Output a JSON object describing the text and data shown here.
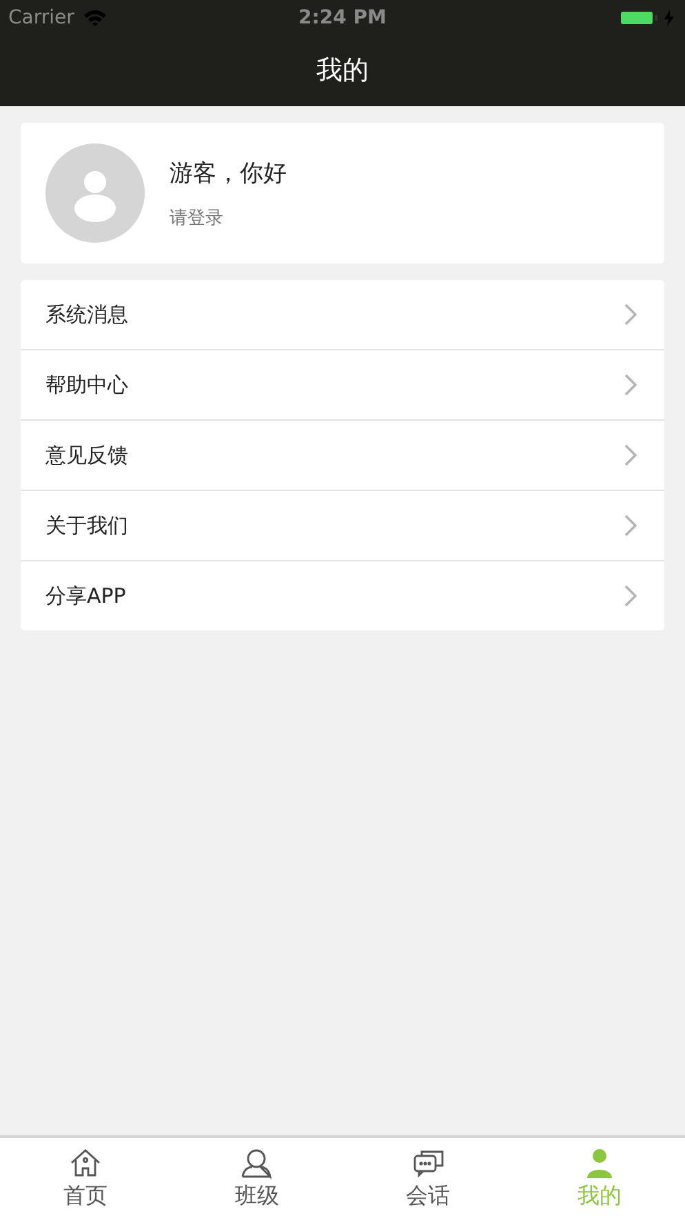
{
  "status_bar": {
    "carrier": "Carrier",
    "time": "2:24 PM"
  },
  "nav_bar": {
    "title": "我的"
  },
  "profile": {
    "name": "游客，你好",
    "subtitle": "请登录"
  },
  "menu": [
    {
      "label": "系统消息"
    },
    {
      "label": "帮助中心"
    },
    {
      "label": "意见反馈"
    },
    {
      "label": "关于我们"
    },
    {
      "label": "分享APP"
    }
  ],
  "tab_bar": [
    {
      "label": "首页",
      "kind": "home",
      "selected": false
    },
    {
      "label": "班级",
      "kind": "class",
      "selected": false
    },
    {
      "label": "会话",
      "kind": "chat",
      "selected": false
    },
    {
      "label": "我的",
      "kind": "me",
      "selected": true
    }
  ]
}
